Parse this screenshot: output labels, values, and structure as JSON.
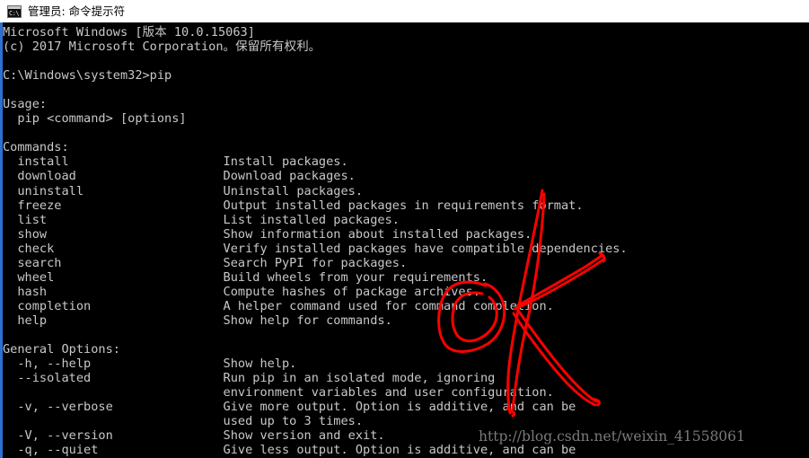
{
  "window": {
    "title": "管理员: 命令提示符",
    "icon": "cmd-icon",
    "icon_glyph": "C:\\",
    "titlebar_bg": "#ffffff",
    "console_bg": "#000000",
    "console_fg": "#c8c8c8",
    "accent_edge": "#2f6fd0"
  },
  "terminal": {
    "banner": [
      "Microsoft Windows [版本 10.0.15063]",
      "(c) 2017 Microsoft Corporation。保留所有权利。"
    ],
    "prompt_line": "C:\\Windows\\system32>pip",
    "usage_heading": "Usage:",
    "usage_line": "  pip <command> [options]",
    "commands_heading": "Commands:",
    "commands": [
      {
        "name": "install",
        "desc": "Install packages."
      },
      {
        "name": "download",
        "desc": "Download packages."
      },
      {
        "name": "uninstall",
        "desc": "Uninstall packages."
      },
      {
        "name": "freeze",
        "desc": "Output installed packages in requirements format."
      },
      {
        "name": "list",
        "desc": "List installed packages."
      },
      {
        "name": "show",
        "desc": "Show information about installed packages."
      },
      {
        "name": "check",
        "desc": "Verify installed packages have compatible dependencies."
      },
      {
        "name": "search",
        "desc": "Search PyPI for packages."
      },
      {
        "name": "wheel",
        "desc": "Build wheels from your requirements."
      },
      {
        "name": "hash",
        "desc": "Compute hashes of package archives."
      },
      {
        "name": "completion",
        "desc": "A helper command used for command completion."
      },
      {
        "name": "help",
        "desc": "Show help for commands."
      }
    ],
    "options_heading": "General Options:",
    "options": [
      {
        "flag": "-h, --help",
        "desc": [
          "Show help."
        ]
      },
      {
        "flag": "--isolated",
        "desc": [
          "Run pip in an isolated mode, ignoring",
          "environment variables and user configuration."
        ]
      },
      {
        "flag": "-v, --verbose",
        "desc": [
          "Give more output. Option is additive, and can be",
          "used up to 3 times."
        ]
      },
      {
        "flag": "-V, --version",
        "desc": [
          "Show version and exit."
        ]
      },
      {
        "flag": "-q, --quiet",
        "desc": [
          "Give less output. Option is additive, and can be"
        ]
      }
    ],
    "desc_column": 30,
    "indent": 2
  },
  "watermark": {
    "text": "http://blog.csdn.net/weixin_41558061",
    "color": "#7a7a7a"
  },
  "annotations": {
    "color": "#fe0000",
    "stroke_width": 3,
    "shapes": [
      {
        "name": "letter-k-mark",
        "kind": "handdrawn-K"
      },
      {
        "name": "oval-circle-mark",
        "kind": "handdrawn-oval"
      }
    ]
  }
}
